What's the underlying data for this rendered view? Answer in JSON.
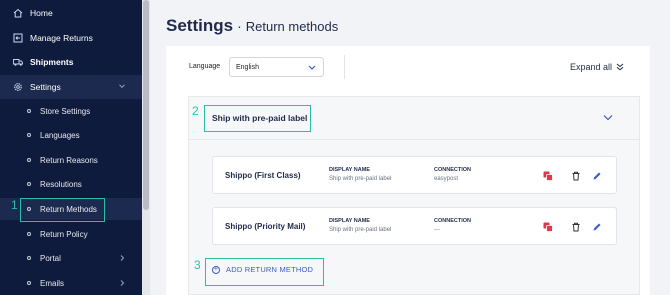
{
  "sidebar": {
    "items": [
      {
        "label": "Home",
        "icon": "home-icon"
      },
      {
        "label": "Manage Returns",
        "icon": "returns-icon"
      },
      {
        "label": "Shipments",
        "icon": "truck-icon"
      },
      {
        "label": "Settings",
        "icon": "gear-icon"
      }
    ],
    "settings_sub": [
      {
        "label": "Store Settings"
      },
      {
        "label": "Languages"
      },
      {
        "label": "Return Reasons"
      },
      {
        "label": "Resolutions"
      },
      {
        "label": "Return Methods"
      },
      {
        "label": "Return Policy"
      },
      {
        "label": "Portal"
      },
      {
        "label": "Emails"
      }
    ]
  },
  "annotations": [
    "1",
    "2",
    "3"
  ],
  "page": {
    "title": "Settings",
    "separator": "·",
    "subtitle": "Return methods"
  },
  "toolbar": {
    "language_label": "Language",
    "language_value": "English",
    "expand_label": "Expand all"
  },
  "section": {
    "title": "Ship with pre-paid label",
    "columns": {
      "display": "DISPLAY NAME",
      "connection": "CONNECTION"
    },
    "methods": [
      {
        "name": "Shippo (First Class)",
        "display_name": "Ship with pre-paid label",
        "connection": "easypost"
      },
      {
        "name": "Shippo (Priority Mail)",
        "display_name": "Ship with pre-paid label",
        "connection": "---"
      }
    ],
    "add_label": "ADD RETURN METHOD"
  },
  "colors": {
    "sidebar": "#0f1b3d",
    "accent": "#2bbfa6",
    "link": "#3b5bcc",
    "danger": "#e0384b"
  }
}
